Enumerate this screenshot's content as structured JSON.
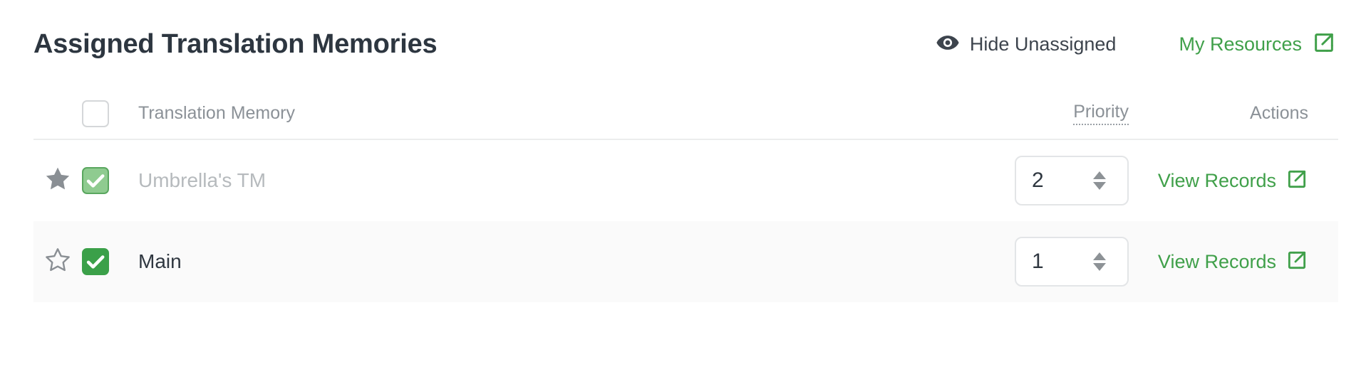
{
  "header": {
    "title": "Assigned Translation Memories",
    "hide_unassigned": {
      "label": "Hide Unassigned",
      "icon": "eye-icon"
    },
    "my_resources": {
      "label": "My Resources",
      "icon": "external-link-icon"
    }
  },
  "table": {
    "columns": {
      "select_all_checkbox": "unchecked",
      "name": "Translation Memory",
      "priority": "Priority",
      "actions": "Actions"
    },
    "rows": [
      {
        "favorite": false,
        "favorite_icon": "star-filled-icon",
        "checkbox": "checked-disabled",
        "name": "Umbrella's TM",
        "priority": "2",
        "action_label": "View Records",
        "action_icon": "external-link-icon"
      },
      {
        "favorite": false,
        "favorite_icon": "star-outline-icon",
        "checkbox": "checked",
        "name": "Main",
        "priority": "1",
        "action_label": "View Records",
        "action_icon": "external-link-icon"
      }
    ]
  },
  "colors": {
    "accent_green": "#40a04a",
    "checkbox_green": "#3ba049",
    "checkbox_green_muted": "#8fcb90",
    "title_dark": "#2d3640",
    "muted_text": "#8b9197",
    "row_alt_bg": "#fafafa",
    "border": "#eceded"
  }
}
